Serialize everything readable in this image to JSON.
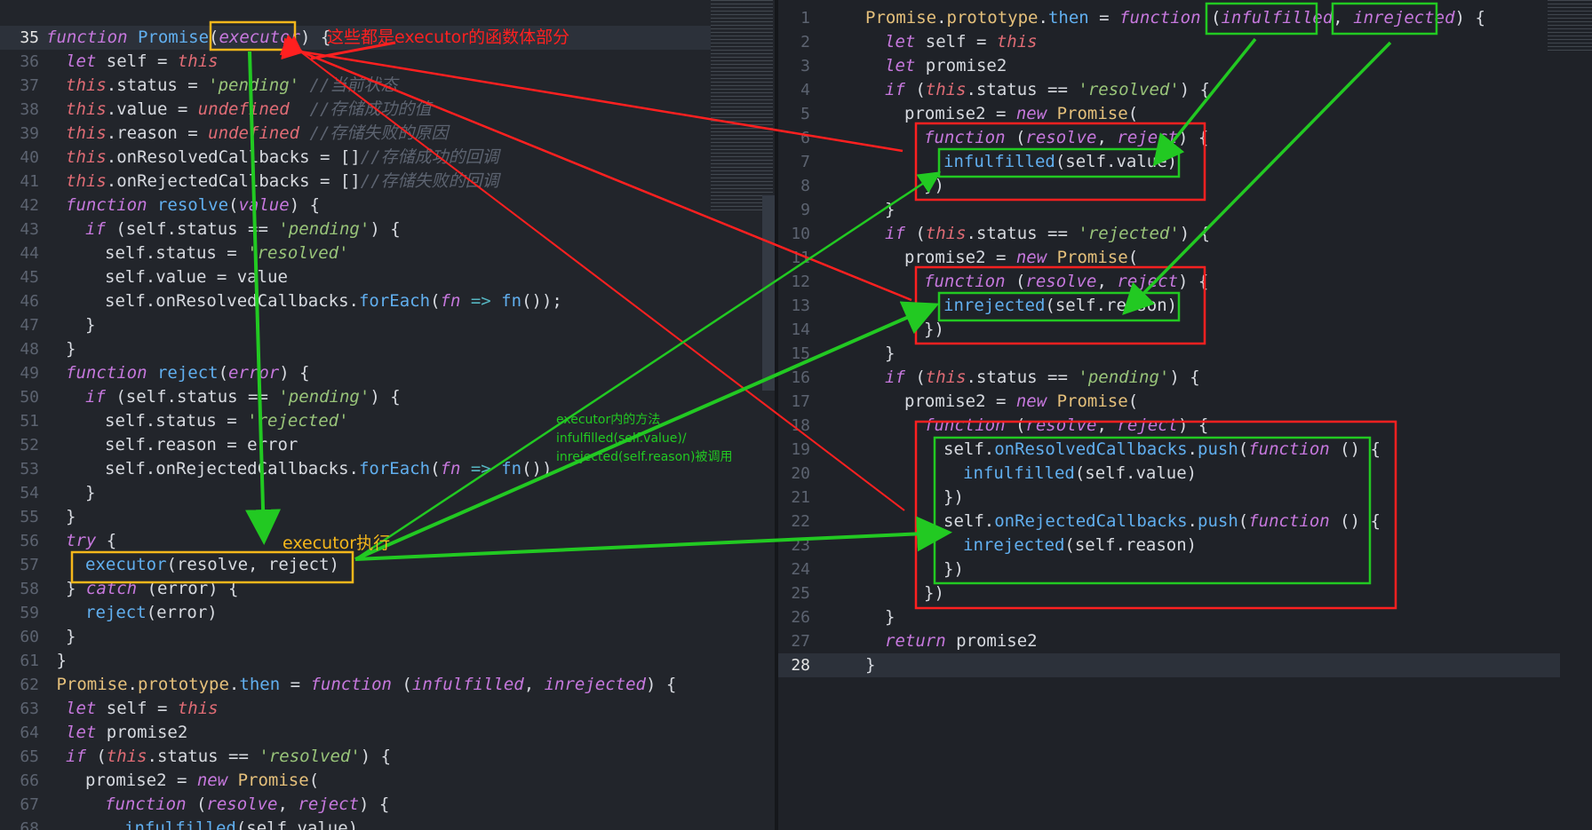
{
  "left": {
    "lines": [
      {
        "n": "35",
        "active": true,
        "indent": 0,
        "tokens": [
          [
            "k",
            "function "
          ],
          [
            "fn",
            "Promise"
          ],
          [
            "pl",
            "("
          ],
          [
            "prm",
            "executor"
          ],
          [
            "pl",
            ") {"
          ]
        ]
      },
      {
        "n": "36",
        "indent": 1,
        "tokens": [
          [
            "k",
            "let "
          ],
          [
            "pl",
            "self = "
          ],
          [
            "kt",
            "this"
          ]
        ]
      },
      {
        "n": "37",
        "indent": 1,
        "tokens": [
          [
            "kt",
            "this"
          ],
          [
            "pl",
            ".status = "
          ],
          [
            "str",
            "'pending'"
          ],
          [
            "cm",
            " //当前状态"
          ]
        ]
      },
      {
        "n": "38",
        "indent": 1,
        "tokens": [
          [
            "kt",
            "this"
          ],
          [
            "pl",
            ".value = "
          ],
          [
            "kt",
            "undefined"
          ],
          [
            "cm",
            "  //存储成功的值"
          ]
        ]
      },
      {
        "n": "39",
        "indent": 1,
        "tokens": [
          [
            "kt",
            "this"
          ],
          [
            "pl",
            ".reason = "
          ],
          [
            "kt",
            "undefined"
          ],
          [
            "cm",
            " //存储失败的原因"
          ]
        ]
      },
      {
        "n": "40",
        "indent": 1,
        "tokens": [
          [
            "kt",
            "this"
          ],
          [
            "pl",
            ".onResolvedCallbacks = []"
          ],
          [
            "cm",
            "//存储成功的回调"
          ]
        ]
      },
      {
        "n": "41",
        "indent": 1,
        "tokens": [
          [
            "kt",
            "this"
          ],
          [
            "pl",
            ".onRejectedCallbacks = []"
          ],
          [
            "cm",
            "//存储失败的回调"
          ]
        ]
      },
      {
        "n": "42",
        "indent": 1,
        "tokens": [
          [
            "k",
            "function "
          ],
          [
            "fn",
            "resolve"
          ],
          [
            "pl",
            "("
          ],
          [
            "prm",
            "value"
          ],
          [
            "pl",
            ") {"
          ]
        ]
      },
      {
        "n": "43",
        "indent": 2,
        "tokens": [
          [
            "k",
            "if "
          ],
          [
            "pl",
            "(self.status == "
          ],
          [
            "str",
            "'pending'"
          ],
          [
            "pl",
            ") {"
          ]
        ]
      },
      {
        "n": "44",
        "indent": 3,
        "tokens": [
          [
            "pl",
            "self.status = "
          ],
          [
            "str",
            "'resolved'"
          ]
        ]
      },
      {
        "n": "45",
        "indent": 3,
        "tokens": [
          [
            "pl",
            "self.value = value"
          ]
        ]
      },
      {
        "n": "46",
        "indent": 3,
        "tokens": [
          [
            "pl",
            "self.onResolvedCallbacks."
          ],
          [
            "fn",
            "forEach"
          ],
          [
            "pl",
            "("
          ],
          [
            "prm",
            "fn"
          ],
          [
            "op",
            " => "
          ],
          [
            "fn",
            "fn"
          ],
          [
            "pl",
            "());"
          ]
        ]
      },
      {
        "n": "47",
        "indent": 2,
        "tokens": [
          [
            "pl",
            "}"
          ]
        ]
      },
      {
        "n": "48",
        "indent": 1,
        "tokens": [
          [
            "pl",
            "}"
          ]
        ]
      },
      {
        "n": "49",
        "indent": 1,
        "tokens": [
          [
            "k",
            "function "
          ],
          [
            "fn",
            "reject"
          ],
          [
            "pl",
            "("
          ],
          [
            "prm",
            "error"
          ],
          [
            "pl",
            ") {"
          ]
        ]
      },
      {
        "n": "50",
        "indent": 2,
        "tokens": [
          [
            "k",
            "if "
          ],
          [
            "pl",
            "(self.status == "
          ],
          [
            "str",
            "'pending'"
          ],
          [
            "pl",
            ") {"
          ]
        ]
      },
      {
        "n": "51",
        "indent": 3,
        "tokens": [
          [
            "pl",
            "self.status = "
          ],
          [
            "str",
            "'rejected'"
          ]
        ]
      },
      {
        "n": "52",
        "indent": 3,
        "tokens": [
          [
            "pl",
            "self.reason = error"
          ]
        ]
      },
      {
        "n": "53",
        "indent": 3,
        "tokens": [
          [
            "pl",
            "self.onRejectedCallbacks."
          ],
          [
            "fn",
            "forEach"
          ],
          [
            "pl",
            "("
          ],
          [
            "prm",
            "fn"
          ],
          [
            "op",
            " => "
          ],
          [
            "fn",
            "fn"
          ],
          [
            "pl",
            "())"
          ]
        ]
      },
      {
        "n": "54",
        "indent": 2,
        "tokens": [
          [
            "pl",
            "}"
          ]
        ]
      },
      {
        "n": "55",
        "indent": 1,
        "tokens": [
          [
            "pl",
            "}"
          ]
        ]
      },
      {
        "n": "56",
        "indent": 1,
        "tokens": [
          [
            "k",
            "try "
          ],
          [
            "pl",
            "{"
          ]
        ]
      },
      {
        "n": "57",
        "indent": 2,
        "tokens": [
          [
            "fn",
            "executor"
          ],
          [
            "pl",
            "(resolve, reject)"
          ]
        ]
      },
      {
        "n": "58",
        "indent": 1,
        "tokens": [
          [
            "pl",
            "} "
          ],
          [
            "k",
            "catch "
          ],
          [
            "pl",
            "(error) {"
          ]
        ]
      },
      {
        "n": "59",
        "indent": 2,
        "tokens": [
          [
            "fn",
            "reject"
          ],
          [
            "pl",
            "(error)"
          ]
        ]
      },
      {
        "n": "60",
        "indent": 1,
        "tokens": [
          [
            "pl",
            "}"
          ]
        ]
      },
      {
        "n": "61",
        "indent": 0,
        "tokens": [
          [
            "pl",
            " }"
          ]
        ]
      },
      {
        "n": "62",
        "indent": 0,
        "tokens": [
          [
            "cls",
            " Promise"
          ],
          [
            "pl",
            "."
          ],
          [
            "cls",
            "prototype"
          ],
          [
            "pl",
            "."
          ],
          [
            "fn",
            "then"
          ],
          [
            "pl",
            " = "
          ],
          [
            "k",
            "function "
          ],
          [
            "pl",
            "("
          ],
          [
            "prm",
            "infulfilled"
          ],
          [
            "pl",
            ", "
          ],
          [
            "prm",
            "inrejected"
          ],
          [
            "pl",
            ") {"
          ]
        ]
      },
      {
        "n": "63",
        "indent": 1,
        "tokens": [
          [
            "k",
            "let "
          ],
          [
            "pl",
            "self = "
          ],
          [
            "kt",
            "this"
          ]
        ]
      },
      {
        "n": "64",
        "indent": 1,
        "tokens": [
          [
            "k",
            "let "
          ],
          [
            "pl",
            "promise2"
          ]
        ]
      },
      {
        "n": "65",
        "indent": 1,
        "tokens": [
          [
            "k",
            "if "
          ],
          [
            "pl",
            "("
          ],
          [
            "kt",
            "this"
          ],
          [
            "pl",
            ".status == "
          ],
          [
            "str",
            "'resolved'"
          ],
          [
            "pl",
            ") {"
          ]
        ]
      },
      {
        "n": "66",
        "indent": 2,
        "tokens": [
          [
            "pl",
            "promise2 = "
          ],
          [
            "k",
            "new "
          ],
          [
            "cls",
            "Promise"
          ],
          [
            "pl",
            "("
          ]
        ]
      },
      {
        "n": "67",
        "indent": 3,
        "tokens": [
          [
            "k",
            "function "
          ],
          [
            "pl",
            "("
          ],
          [
            "prm",
            "resolve"
          ],
          [
            "pl",
            ", "
          ],
          [
            "prm",
            "reject"
          ],
          [
            "pl",
            ") {"
          ]
        ]
      },
      {
        "n": "68",
        "indent": 4,
        "tokens": [
          [
            "fn",
            "infulfilled"
          ],
          [
            "pl",
            "(self.value)"
          ]
        ]
      }
    ]
  },
  "right": {
    "lines": [
      {
        "n": "1",
        "indent": 0,
        "tokens": [
          [
            "cls",
            "Promise"
          ],
          [
            "pl",
            "."
          ],
          [
            "cls",
            "prototype"
          ],
          [
            "pl",
            "."
          ],
          [
            "fn",
            "then"
          ],
          [
            "pl",
            " = "
          ],
          [
            "k",
            "function "
          ],
          [
            "pl",
            "("
          ],
          [
            "prm",
            "infulfilled"
          ],
          [
            "pl",
            ", "
          ],
          [
            "prm",
            "inrejected"
          ],
          [
            "pl",
            ") {"
          ]
        ]
      },
      {
        "n": "2",
        "indent": 1,
        "tokens": [
          [
            "k",
            "let "
          ],
          [
            "pl",
            "self = "
          ],
          [
            "kt",
            "this"
          ]
        ]
      },
      {
        "n": "3",
        "indent": 1,
        "tokens": [
          [
            "k",
            "let "
          ],
          [
            "pl",
            "promise2"
          ]
        ]
      },
      {
        "n": "4",
        "indent": 1,
        "tokens": [
          [
            "k",
            "if "
          ],
          [
            "pl",
            "("
          ],
          [
            "kt",
            "this"
          ],
          [
            "pl",
            ".status == "
          ],
          [
            "str",
            "'resolved'"
          ],
          [
            "pl",
            ") {"
          ]
        ]
      },
      {
        "n": "5",
        "indent": 2,
        "tokens": [
          [
            "pl",
            "promise2 = "
          ],
          [
            "k",
            "new "
          ],
          [
            "cls",
            "Promise"
          ],
          [
            "pl",
            "("
          ]
        ]
      },
      {
        "n": "6",
        "indent": 3,
        "tokens": [
          [
            "k",
            "function "
          ],
          [
            "pl",
            "("
          ],
          [
            "prm",
            "resolve"
          ],
          [
            "pl",
            ", "
          ],
          [
            "prm",
            "reject"
          ],
          [
            "pl",
            ") {"
          ]
        ]
      },
      {
        "n": "7",
        "indent": 4,
        "tokens": [
          [
            "fn",
            "infulfilled"
          ],
          [
            "pl",
            "(self.value)"
          ]
        ]
      },
      {
        "n": "8",
        "indent": 3,
        "tokens": [
          [
            "pl",
            "})"
          ]
        ]
      },
      {
        "n": "9",
        "indent": 1,
        "tokens": [
          [
            "pl",
            "}"
          ]
        ]
      },
      {
        "n": "10",
        "indent": 1,
        "tokens": [
          [
            "k",
            "if "
          ],
          [
            "pl",
            "("
          ],
          [
            "kt",
            "this"
          ],
          [
            "pl",
            ".status == "
          ],
          [
            "str",
            "'rejected'"
          ],
          [
            "pl",
            ") {"
          ]
        ]
      },
      {
        "n": "11",
        "indent": 2,
        "tokens": [
          [
            "pl",
            "promise2 = "
          ],
          [
            "k",
            "new "
          ],
          [
            "cls",
            "Promise"
          ],
          [
            "pl",
            "("
          ]
        ]
      },
      {
        "n": "12",
        "indent": 3,
        "tokens": [
          [
            "k",
            "function "
          ],
          [
            "pl",
            "("
          ],
          [
            "prm",
            "resolve"
          ],
          [
            "pl",
            ", "
          ],
          [
            "prm",
            "reject"
          ],
          [
            "pl",
            ") {"
          ]
        ]
      },
      {
        "n": "13",
        "indent": 4,
        "tokens": [
          [
            "fn",
            "inrejected"
          ],
          [
            "pl",
            "(self.reason)"
          ]
        ]
      },
      {
        "n": "14",
        "indent": 3,
        "tokens": [
          [
            "pl",
            "})"
          ]
        ]
      },
      {
        "n": "15",
        "indent": 1,
        "tokens": [
          [
            "pl",
            "}"
          ]
        ]
      },
      {
        "n": "16",
        "indent": 1,
        "tokens": [
          [
            "k",
            "if "
          ],
          [
            "pl",
            "("
          ],
          [
            "kt",
            "this"
          ],
          [
            "pl",
            ".status == "
          ],
          [
            "str",
            "'pending'"
          ],
          [
            "pl",
            ") {"
          ]
        ]
      },
      {
        "n": "17",
        "indent": 2,
        "tokens": [
          [
            "pl",
            "promise2 = "
          ],
          [
            "k",
            "new "
          ],
          [
            "cls",
            "Promise"
          ],
          [
            "pl",
            "("
          ]
        ]
      },
      {
        "n": "18",
        "indent": 3,
        "tokens": [
          [
            "k",
            "function "
          ],
          [
            "pl",
            "("
          ],
          [
            "prm",
            "resolve"
          ],
          [
            "pl",
            ", "
          ],
          [
            "prm",
            "reject"
          ],
          [
            "pl",
            ") {"
          ]
        ]
      },
      {
        "n": "19",
        "indent": 4,
        "tokens": [
          [
            "pl",
            "self."
          ],
          [
            "fn",
            "onResolvedCallbacks"
          ],
          [
            "pl",
            "."
          ],
          [
            "fn",
            "push"
          ],
          [
            "pl",
            "("
          ],
          [
            "k",
            "function "
          ],
          [
            "pl",
            "() {"
          ]
        ]
      },
      {
        "n": "20",
        "indent": 5,
        "tokens": [
          [
            "fn",
            "infulfilled"
          ],
          [
            "pl",
            "(self.value)"
          ]
        ]
      },
      {
        "n": "21",
        "indent": 4,
        "tokens": [
          [
            "pl",
            "})"
          ]
        ]
      },
      {
        "n": "22",
        "indent": 4,
        "tokens": [
          [
            "pl",
            "self."
          ],
          [
            "fn",
            "onRejectedCallbacks"
          ],
          [
            "pl",
            "."
          ],
          [
            "fn",
            "push"
          ],
          [
            "pl",
            "("
          ],
          [
            "k",
            "function "
          ],
          [
            "pl",
            "() {"
          ]
        ]
      },
      {
        "n": "23",
        "indent": 5,
        "tokens": [
          [
            "fn",
            "inrejected"
          ],
          [
            "pl",
            "(self.reason)"
          ]
        ]
      },
      {
        "n": "24",
        "indent": 4,
        "tokens": [
          [
            "pl",
            "})"
          ]
        ]
      },
      {
        "n": "25",
        "indent": 3,
        "tokens": [
          [
            "pl",
            "})"
          ]
        ]
      },
      {
        "n": "26",
        "indent": 1,
        "tokens": [
          [
            "pl",
            "}"
          ]
        ]
      },
      {
        "n": "27",
        "indent": 1,
        "tokens": [
          [
            "k",
            "return "
          ],
          [
            "pl",
            "promise2"
          ]
        ]
      },
      {
        "n": "28",
        "active": true,
        "indent": 0,
        "tokens": [
          [
            "pl",
            "}"
          ]
        ]
      }
    ]
  },
  "annotations": {
    "executor_body": "这些都是executor的函数体部分",
    "executor_runs": "executor执行",
    "methods_called": [
      "executor内的方法",
      "infulfilled(self.value)/",
      "inrejected(self.reason)被调用"
    ]
  },
  "colors": {
    "red": "#ff2020",
    "green": "#22c922",
    "yellow": "#f5b71b"
  }
}
